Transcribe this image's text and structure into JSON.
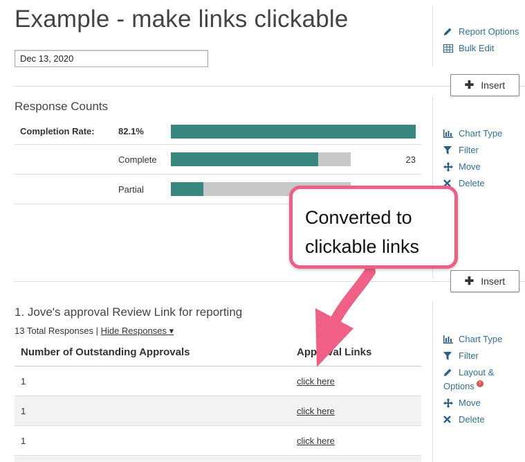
{
  "header": {
    "title": "Example - make links clickable"
  },
  "date_field": {
    "value": "Dec 13, 2020"
  },
  "page_actions": {
    "report_options": "Report Options",
    "bulk_edit": "Bulk Edit"
  },
  "insert_label": "Insert",
  "response_counts": {
    "title": "Response Counts",
    "rows": [
      {
        "label": "Completion Rate:",
        "value": "82.1%",
        "fill": 1.0,
        "count": ""
      },
      {
        "label": "Complete",
        "value": "",
        "fill": 0.82,
        "count": "23"
      },
      {
        "label": "Partial",
        "value": "",
        "fill": 0.18,
        "count": ""
      }
    ],
    "actions": {
      "chart_type": "Chart Type",
      "filter": "Filter",
      "move": "Move",
      "delete": "Delete"
    }
  },
  "callout": {
    "line1": "Converted to",
    "line2": "clickable links"
  },
  "question": {
    "title": "1. Jove's approval Review Link for reporting",
    "total": "13 Total Responses",
    "separator": " | ",
    "hide_label": "Hide Responses",
    "columns": [
      "Number of Outstanding Approvals",
      "Approval Links"
    ],
    "rows": [
      {
        "count": "1",
        "link": "click here"
      },
      {
        "count": "1",
        "link": "click here"
      },
      {
        "count": "1",
        "link": "click here"
      }
    ],
    "actions": {
      "chart_type": "Chart Type",
      "filter": "Filter",
      "layout_options_1": "Layout &",
      "layout_options_2": "Options",
      "move": "Move",
      "delete": "Delete"
    }
  },
  "colors": {
    "bar_fill": "#38877f",
    "bar_bg": "#c8c8c8",
    "link": "#2f6f9f",
    "callout_border": "#ef5f86",
    "info_badge": "#d9534f"
  }
}
